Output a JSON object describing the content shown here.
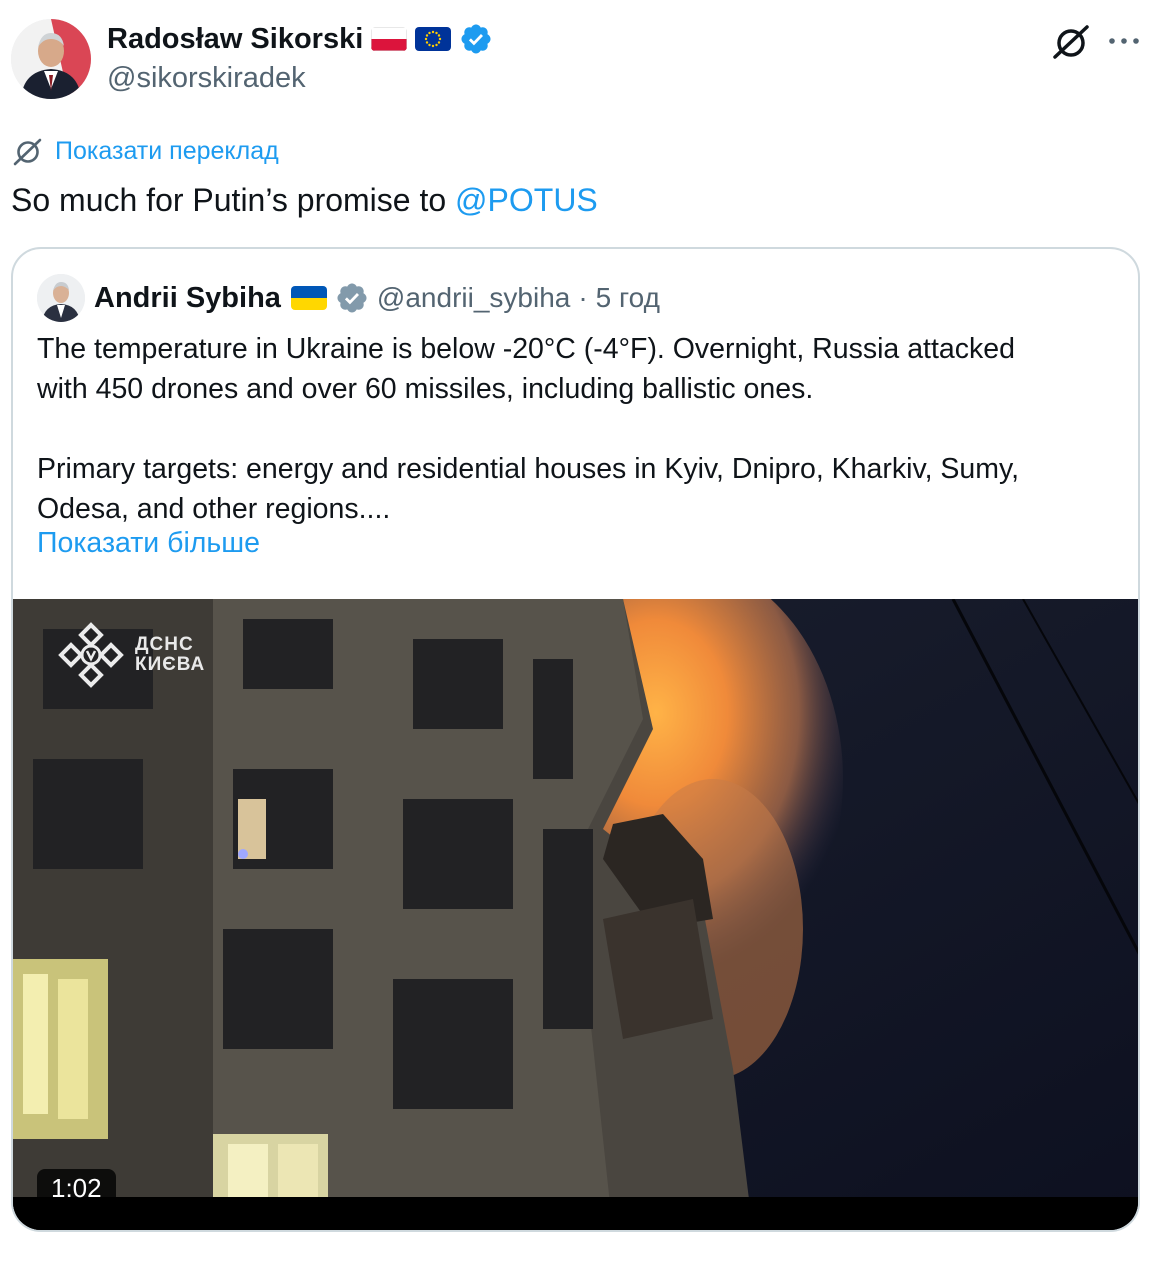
{
  "author": {
    "display_name": "Radosław Sikorski",
    "handle": "@sikorskiradek",
    "flags": [
      "poland-flag",
      "eu-flag"
    ],
    "verified_color": "#1d9bf0"
  },
  "actions": {
    "grok_icon": "grok-icon",
    "more_icon": "more-icon"
  },
  "translate": {
    "label": "Показати переклад",
    "icon": "translate-icon"
  },
  "tweet": {
    "text_prefix": "So much for Putin’s promise to ",
    "mention": "@POTUS"
  },
  "quote": {
    "display_name": "Andrii Sybiha",
    "flag": "ukraine-flag",
    "handle": "@andrii_sybiha",
    "separator": "·",
    "time": "5 год",
    "paragraphs": [
      [
        "The temperature in Ukraine is below -20°C (-4°F). Overnight, Russia attacked",
        "with 450 drones and over 60 missiles, including ballistic ones."
      ],
      [
        "Primary targets: energy and residential houses in Kyiv, Dnipro, Kharkiv, Sumy,",
        "Odesa, and other regions...."
      ]
    ],
    "show_more": "Показати більше",
    "video": {
      "watermark_line1": "ДСНС",
      "watermark_line2": "КИЄВА",
      "duration": "1:02"
    }
  },
  "colors": {
    "link": "#1d9bf0",
    "text": "#0f1419",
    "secondary": "#536471",
    "border": "#cfd9de",
    "verified_gray": "#829aab"
  }
}
